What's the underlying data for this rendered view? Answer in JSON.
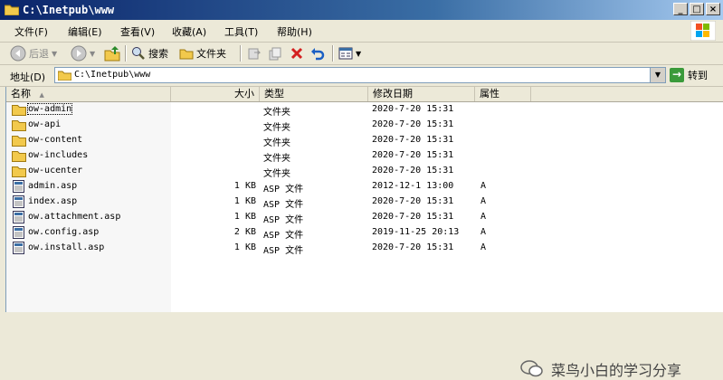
{
  "window": {
    "title": "C:\\Inetpub\\www",
    "buttons": [
      "_",
      "□",
      "×"
    ]
  },
  "menu": [
    {
      "label": "文件(F)"
    },
    {
      "label": "编辑(E)"
    },
    {
      "label": "查看(V)"
    },
    {
      "label": "收藏(A)"
    },
    {
      "label": "工具(T)"
    },
    {
      "label": "帮助(H)"
    }
  ],
  "toolbar": {
    "back": "后退",
    "search": "搜索",
    "folders": "文件夹"
  },
  "address": {
    "label": "地址(D)",
    "path": "C:\\Inetpub\\www",
    "go": "转到"
  },
  "columns": [
    "名称",
    "大小",
    "类型",
    "修改日期",
    "属性"
  ],
  "files": [
    {
      "name": "ow-admin",
      "size": "",
      "type": "文件夹",
      "date": "2020-7-20 15:31",
      "attr": "",
      "kind": "folder"
    },
    {
      "name": "ow-api",
      "size": "",
      "type": "文件夹",
      "date": "2020-7-20 15:31",
      "attr": "",
      "kind": "folder"
    },
    {
      "name": "ow-content",
      "size": "",
      "type": "文件夹",
      "date": "2020-7-20 15:31",
      "attr": "",
      "kind": "folder"
    },
    {
      "name": "ow-includes",
      "size": "",
      "type": "文件夹",
      "date": "2020-7-20 15:31",
      "attr": "",
      "kind": "folder"
    },
    {
      "name": "ow-ucenter",
      "size": "",
      "type": "文件夹",
      "date": "2020-7-20 15:31",
      "attr": "",
      "kind": "folder"
    },
    {
      "name": "admin.asp",
      "size": "1 KB",
      "type": "ASP 文件",
      "date": "2012-12-1 13:00",
      "attr": "A",
      "kind": "file"
    },
    {
      "name": "index.asp",
      "size": "1 KB",
      "type": "ASP 文件",
      "date": "2020-7-20 15:31",
      "attr": "A",
      "kind": "file"
    },
    {
      "name": "ow.attachment.asp",
      "size": "1 KB",
      "type": "ASP 文件",
      "date": "2020-7-20 15:31",
      "attr": "A",
      "kind": "file"
    },
    {
      "name": "ow.config.asp",
      "size": "2 KB",
      "type": "ASP 文件",
      "date": "2019-11-25 20:13",
      "attr": "A",
      "kind": "file"
    },
    {
      "name": "ow.install.asp",
      "size": "1 KB",
      "type": "ASP 文件",
      "date": "2020-7-20 15:31",
      "attr": "A",
      "kind": "file"
    }
  ],
  "watermark": "菜鸟小白的学习分享",
  "colors": {
    "titlebar": "#0a246a",
    "folder": "#f2c94c",
    "window_bg": "#ece9d8"
  }
}
